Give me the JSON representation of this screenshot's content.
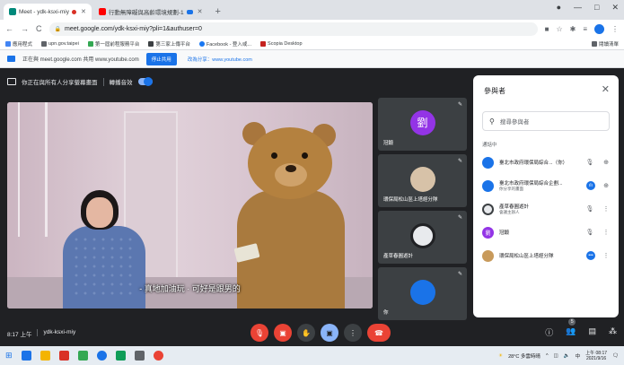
{
  "browser": {
    "tabs": [
      {
        "title": "Meet - ydk-ksxi-miy",
        "active": true
      },
      {
        "title": "行動無障礙與高齡環境規劃-1",
        "active": false
      }
    ],
    "new_tab": "+",
    "window_controls": [
      "—",
      "□",
      "✕"
    ],
    "url": "meet.google.com/ydk-ksxi-miy?pli=1&authuser=0",
    "bookmarks": [
      {
        "label": "應用程式",
        "color": "#4285f4"
      },
      {
        "label": "upn.gov.taipei",
        "color": "#5f6368"
      },
      {
        "label": "第一屆前程服務平台",
        "color": "#34a853"
      },
      {
        "label": "第三家上傳平台",
        "color": "#3c4043"
      },
      {
        "label": "Facebook - 登入或...",
        "color": "#1877f2"
      },
      {
        "label": "Scopia Desktop",
        "color": "#c5221f"
      }
    ],
    "bookmarks_right": "閱讀清單"
  },
  "share_notice": {
    "text": "正在與 meet.google.com 共用 www.youtube.com",
    "stop_label": "停止共用",
    "hide_label": "改為分享：www.youtube.com"
  },
  "presentation": {
    "text": "你正在與所有人分享螢幕畫面",
    "audio_label": "轉播音效"
  },
  "main_video": {
    "caption": "- 真地加油玩 · 可好是跟男的"
  },
  "tiles": [
    {
      "name": "冠鍛",
      "avatar_text": "劉",
      "avatar_color": "#9334e6"
    },
    {
      "name": "環保局松山區上塔經分隊",
      "avatar_text": "",
      "avatar_color": "#d7c2a8"
    },
    {
      "name": "產草春圓遊計",
      "avatar_text": "",
      "avatar_color": "#e8eaed"
    },
    {
      "name": "你",
      "avatar_text": "",
      "avatar_color": "#1a73e8"
    }
  ],
  "participants_panel": {
    "title": "參與者",
    "close_icon": "✕",
    "search_placeholder": "搜尋參與者",
    "section_label": "通話中",
    "people": [
      {
        "name": "臺北市政府環保局綜合...（你）",
        "sub": "",
        "avatar_color": "#1a73e8",
        "avatar_text": "",
        "mic": "🎙̸",
        "action": "⊕"
      },
      {
        "name": "臺北市政府環保局綜合企劃...",
        "sub": "你分享的畫面",
        "avatar_color": "#1a73e8",
        "avatar_text": "",
        "mic": "ılı",
        "action": "⊕"
      },
      {
        "name": "產草春圓遊計",
        "sub": "會議主辦人",
        "avatar_color": "#e8eaed",
        "avatar_text": "",
        "mic": "🎙̸",
        "action": "⋮"
      },
      {
        "name": "冠鍛",
        "sub": "",
        "avatar_color": "#9334e6",
        "avatar_text": "劉",
        "mic": "🎙̸",
        "action": "⋮"
      },
      {
        "name": "環保局松山區上塔經分隊",
        "sub": "",
        "avatar_color": "#c89a5b",
        "avatar_text": "",
        "mic": "…",
        "action": "⋮"
      }
    ]
  },
  "bottom_bar": {
    "time": "8:17 上午",
    "meeting_code": "ydk-ksxi-miy",
    "participant_count": "5"
  },
  "taskbar": {
    "weather": "28°C 多雲時晴",
    "time": "上午 08:17",
    "date": "2021/9/16",
    "apps": [
      "#1b73e8",
      "#f4b400",
      "#d93025",
      "#34a853",
      "#1a73e8",
      "#0f9d58",
      "#5f6368",
      "#ea4335"
    ]
  }
}
